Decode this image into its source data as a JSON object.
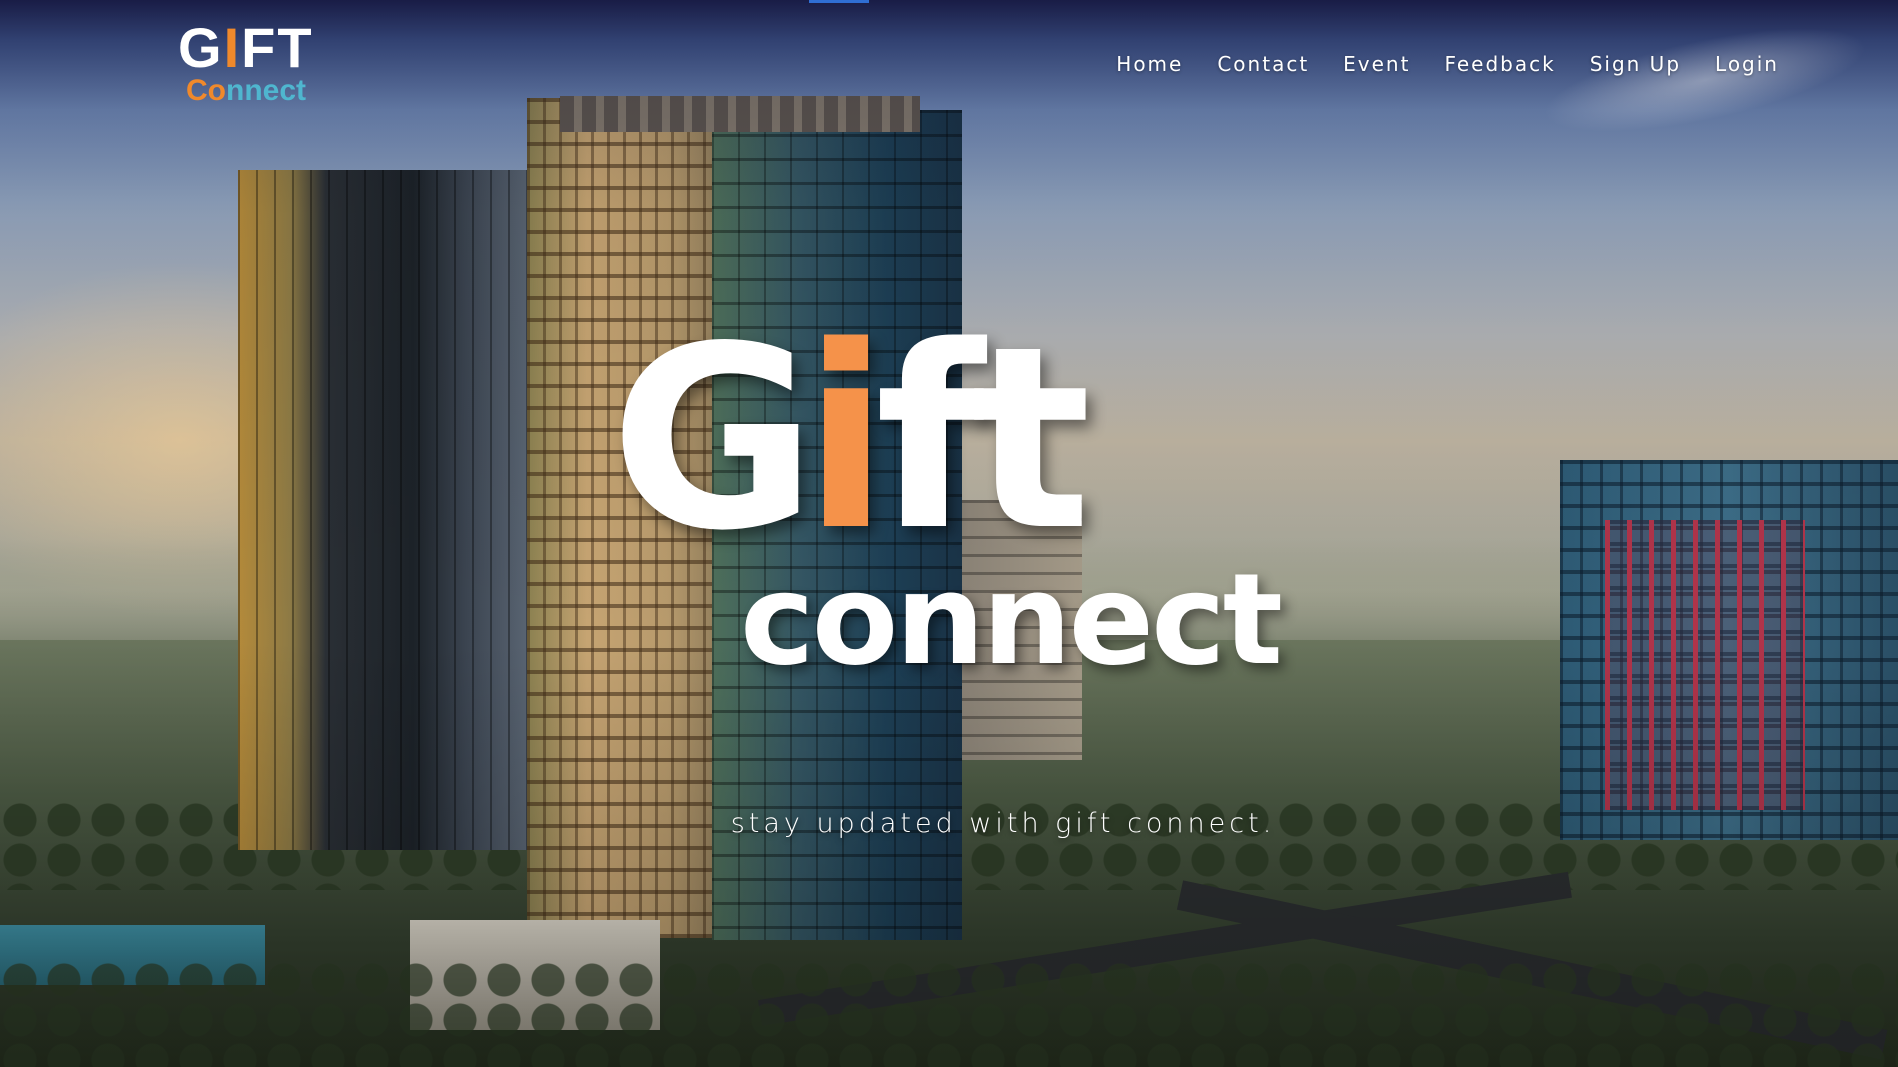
{
  "brand": {
    "gift_prefix": "G",
    "gift_accent": "I",
    "gift_suffix": "FT",
    "connect_accent": "Co",
    "connect_suffix": "nnect"
  },
  "nav": {
    "items": [
      {
        "label": "Home"
      },
      {
        "label": "Contact"
      },
      {
        "label": "Event"
      },
      {
        "label": "Feedback"
      },
      {
        "label": "Sign Up"
      },
      {
        "label": "Login"
      }
    ]
  },
  "hero": {
    "title_prefix": "G",
    "title_accent": "i",
    "title_suffix": "ft",
    "subtitle": "connect",
    "tagline": "stay updated with gift connect."
  },
  "colors": {
    "accent_orange": "#f5924a",
    "accent_teal": "#4fb6cf",
    "nav_text": "#ffffff",
    "top_bar_indicator": "#2f6ed3"
  }
}
